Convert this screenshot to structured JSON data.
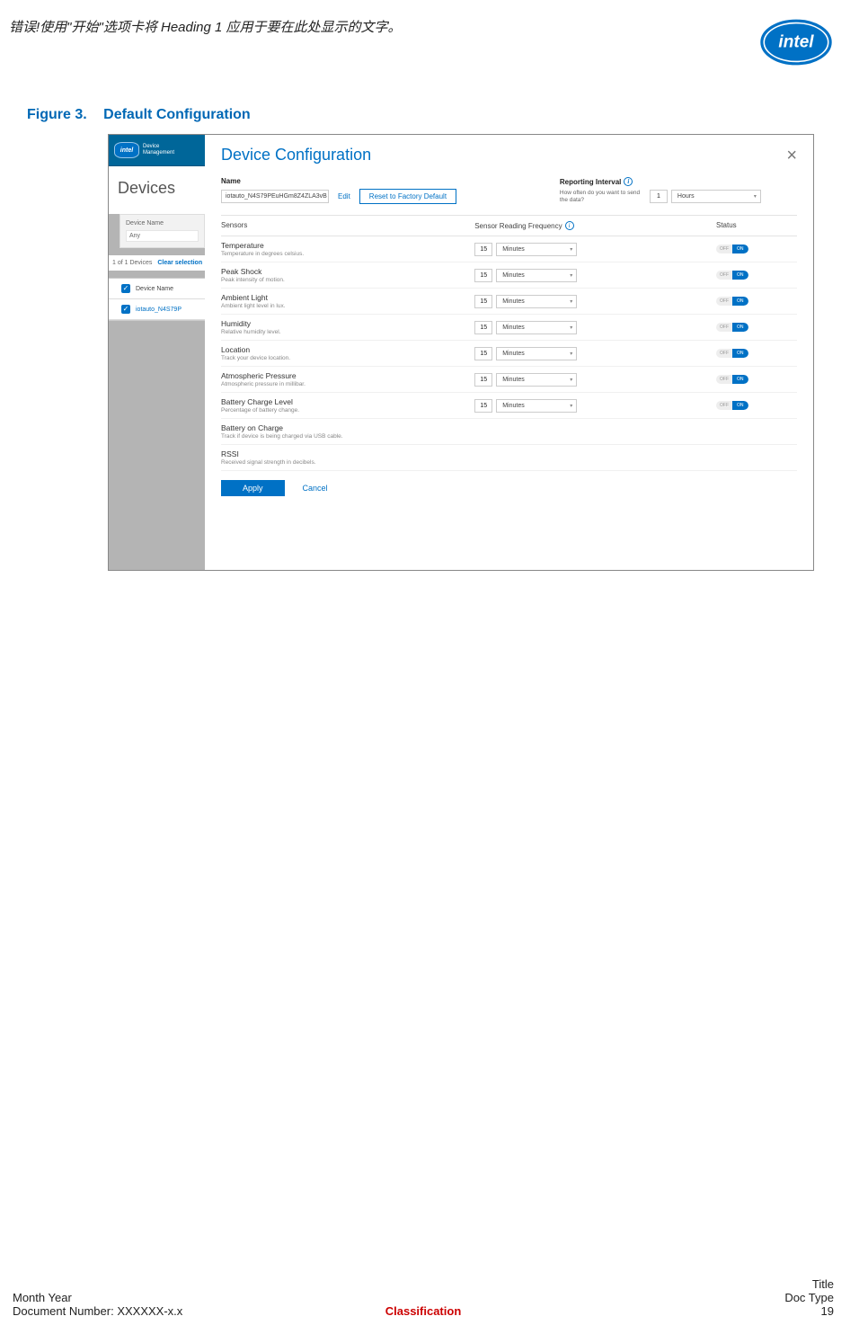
{
  "doc_header": {
    "error_text": "错误!使用\"开始\"选项卡将 Heading 1 应用于要在此处显示的文字。"
  },
  "figure": {
    "prefix": "Figure 3.",
    "title": "Default Configuration"
  },
  "app": {
    "brand_line1": "Device",
    "brand_line2": "Management",
    "brand_logo_text": "intel",
    "sidebar_title": "Devices",
    "filter": {
      "label": "Device Name",
      "value": "Any"
    },
    "count_text": "1 of 1 Devices",
    "clear_text": "Clear selection",
    "device_header": "Device Name",
    "device_selected": "iotauto_N4S79P",
    "panel_title": "Device Configuration",
    "name_label": "Name",
    "name_value": "iotauto_N4S79PEuHGm8Z4ZLA3vB",
    "edit_label": "Edit",
    "reset_label": "Reset to Factory Default",
    "report_label": "Reporting Interval",
    "report_hint": "How often do you want to send the data?",
    "report_value": "1",
    "report_unit": "Hours",
    "table": {
      "h_sensors": "Sensors",
      "h_freq": "Sensor Reading Frequency",
      "h_status": "Status"
    },
    "default_freq_value": "15",
    "default_freq_unit": "Minutes",
    "toggle_off": "OFF",
    "toggle_on": "ON",
    "sensors": [
      {
        "name": "Temperature",
        "desc": "Temperature in degrees celsius.",
        "freq": true,
        "status": true
      },
      {
        "name": "Peak Shock",
        "desc": "Peak intensity of motion.",
        "freq": true,
        "status": true
      },
      {
        "name": "Ambient Light",
        "desc": "Ambient light level in lux.",
        "freq": true,
        "status": true
      },
      {
        "name": "Humidity",
        "desc": "Relative humidity level.",
        "freq": true,
        "status": true
      },
      {
        "name": "Location",
        "desc": "Track your device location.",
        "freq": true,
        "status": true
      },
      {
        "name": "Atmospheric Pressure",
        "desc": "Atmospheric pressure in millibar.",
        "freq": true,
        "status": true
      },
      {
        "name": "Battery Charge Level",
        "desc": "Percentage of battery change.",
        "freq": true,
        "status": true
      },
      {
        "name": "Battery on Charge",
        "desc": "Track if device is being charged via USB cable.",
        "freq": false,
        "status": false
      },
      {
        "name": "RSSI",
        "desc": "Received signal strength in decibels.",
        "freq": false,
        "status": false
      }
    ],
    "apply_label": "Apply",
    "cancel_label": "Cancel"
  },
  "footer": {
    "left1": "Month Year",
    "left2": "Document Number: XXXXXX-x.x",
    "center": "Classification",
    "right1": "Title",
    "right2": "Doc Type",
    "right3": "19"
  }
}
